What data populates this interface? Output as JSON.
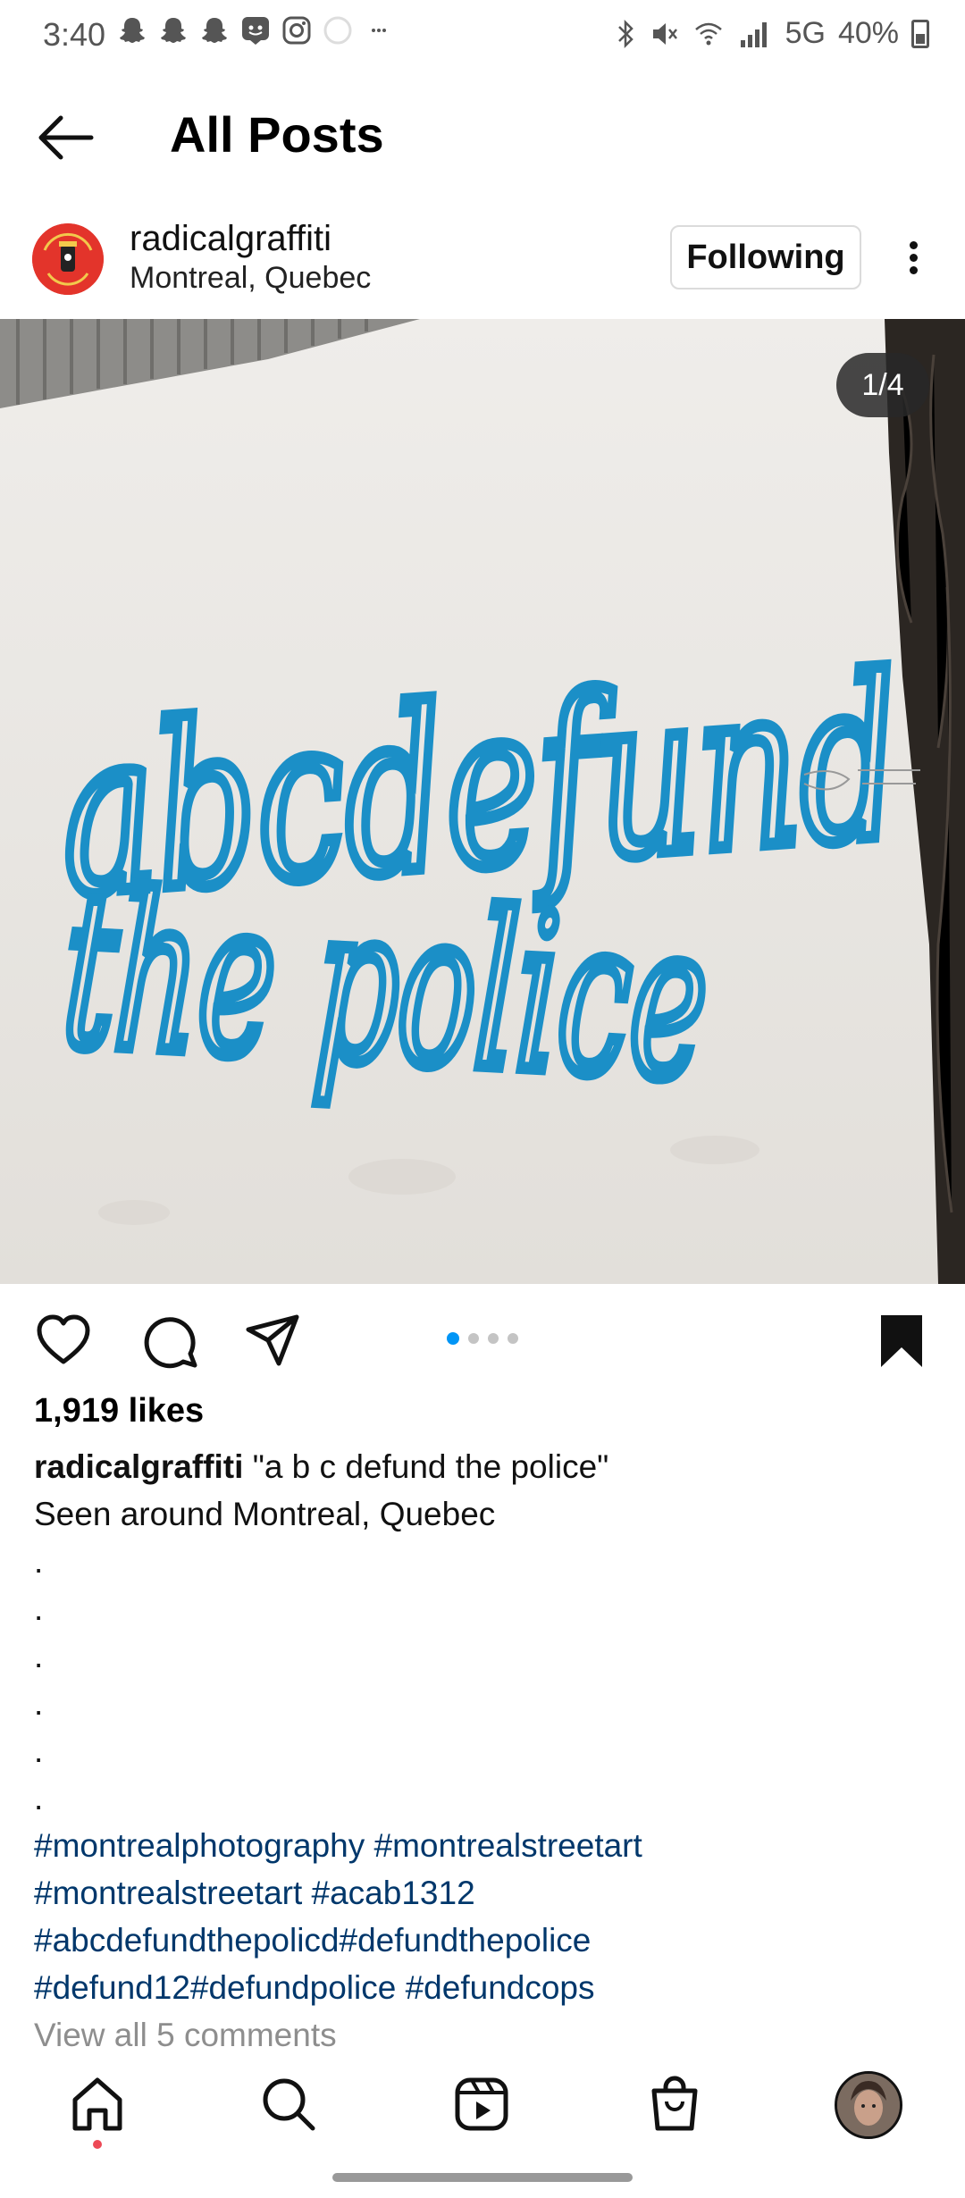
{
  "status_bar": {
    "time": "3:40",
    "signal_text": "5G",
    "battery": "40%"
  },
  "header": {
    "title": "All Posts"
  },
  "post": {
    "username": "radicalgraffiti",
    "location": "Montreal, Quebec",
    "follow_label": "Following",
    "image_counter": "1/4",
    "image_text_line1": "abcdefund",
    "image_text_line2": "the police",
    "carousel_total": 4,
    "carousel_index": 1,
    "likes": "1,919 likes",
    "caption_user": "radicalgraffiti",
    "caption_text": "\"a b c defund the police\"",
    "caption_line2": "Seen around Montreal, Quebec",
    "dot_lines": [
      ".",
      ".",
      ".",
      ".",
      ".",
      "."
    ],
    "hashtag_lines": [
      "#montrealphotography #montrealstreetart",
      "#montrealstreetart #acab1312",
      "#abcdefundthepolicd#defundthepolice",
      "#defund12#defundpolice #defundcops"
    ],
    "view_comments": "View all 5 comments"
  },
  "colors": {
    "accent_blue": "#0095f6",
    "hashtag": "#00376b",
    "graffiti_blue": "#1b8fc7",
    "notification_dot": "#ed4956"
  },
  "icons": {
    "nav": [
      "home-icon",
      "search-icon",
      "reels-icon",
      "shop-icon",
      "profile-avatar"
    ],
    "actions": [
      "heart-icon",
      "comment-icon",
      "share-icon",
      "bookmark-icon"
    ]
  }
}
